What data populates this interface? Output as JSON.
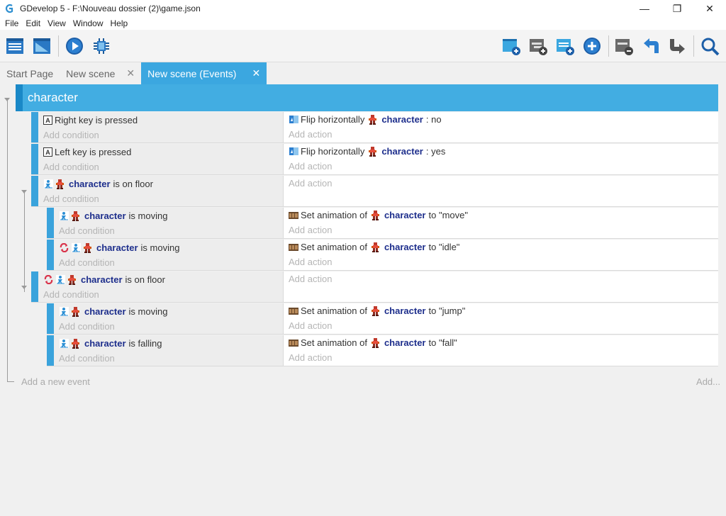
{
  "window": {
    "title": "GDevelop 5 - F:\\Nouveau dossier (2)\\game.json",
    "minimize": "—",
    "maximize": "❐",
    "close": "✕"
  },
  "menu": [
    "File",
    "Edit",
    "View",
    "Window",
    "Help"
  ],
  "toolbar": {
    "left": [
      "project-manager-icon",
      "scene-editor-icon",
      "preview-play-icon",
      "debugger-icon"
    ],
    "right": [
      "add-event-icon",
      "add-subevent-icon",
      "add-comment-icon",
      "add-more-icon",
      "delete-icon",
      "undo-icon",
      "redo-icon",
      "search-icon"
    ]
  },
  "tabs": [
    {
      "label": "Start Page",
      "closable": false,
      "active": false
    },
    {
      "label": "New scene",
      "closable": true,
      "active": false
    },
    {
      "label": "New scene (Events)",
      "closable": true,
      "active": true
    }
  ],
  "tab_close": "✕",
  "group": {
    "title": "character"
  },
  "labels": {
    "add_condition": "Add condition",
    "add_action": "Add action",
    "add_event": "Add a new event",
    "add_more": "Add..."
  },
  "events": [
    {
      "cond": {
        "key": "A",
        "pre": "",
        "obj": "",
        "text": "Right key is pressed"
      },
      "act": {
        "prefix": "Flip horizontally",
        "obj": "character",
        "suffix": ": no"
      }
    },
    {
      "cond": {
        "key": "A",
        "pre": "",
        "obj": "",
        "text": "Left key is pressed"
      },
      "act": {
        "prefix": "Flip horizontally",
        "obj": "character",
        "suffix": ": yes"
      }
    },
    {
      "cond": {
        "obj": "character",
        "text": "is on floor"
      },
      "act": null
    },
    {
      "cond": {
        "obj": "character",
        "text": "is moving"
      },
      "act": {
        "prefix": "Set animation of",
        "obj": "character",
        "suffix": "to \"move\""
      }
    },
    {
      "cond": {
        "obj": "character",
        "text": "is moving"
      },
      "act": {
        "prefix": "Set animation of",
        "obj": "character",
        "suffix": "to \"idle\""
      }
    },
    {
      "cond": {
        "obj": "character",
        "text": "is on floor"
      },
      "act": null
    },
    {
      "cond": {
        "obj": "character",
        "text": "is moving"
      },
      "act": {
        "prefix": "Set animation of",
        "obj": "character",
        "suffix": "to \"jump\""
      }
    },
    {
      "cond": {
        "obj": "character",
        "text": "is falling"
      },
      "act": {
        "prefix": "Set animation of",
        "obj": "character",
        "suffix": "to \"fall\""
      }
    }
  ],
  "colors": {
    "accent": "#3ba7e0",
    "group_header": "#42ade2",
    "object_name": "#1d2e8c"
  }
}
